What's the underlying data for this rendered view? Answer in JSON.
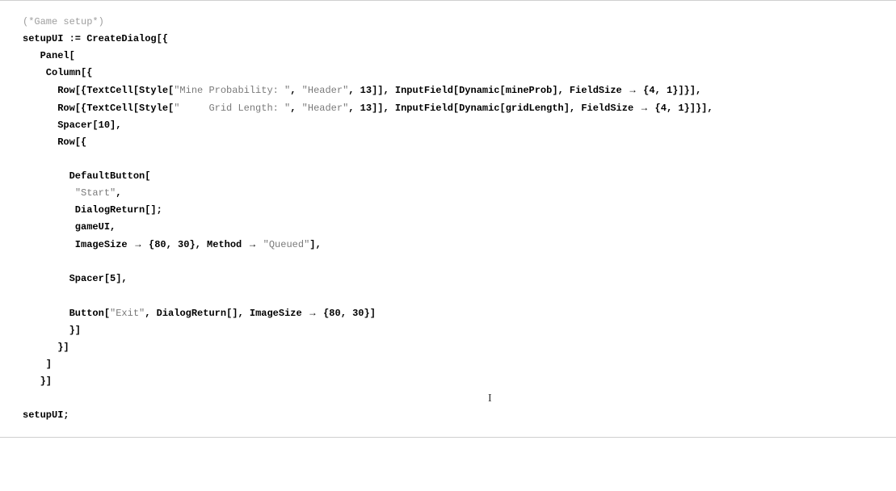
{
  "code": {
    "line1_comment": "(*Game setup*)",
    "line2": "setupUI := CreateDialog[{",
    "line3": "   Panel[",
    "line4": "    Column[{",
    "line5_a": "      Row[{TextCell[Style[",
    "line5_str1": "\"Mine Probability: \"",
    "line5_b": ", ",
    "line5_str2": "\"Header\"",
    "line5_c": ", 13]], InputField[Dynamic[mineProb], FieldSize ",
    "line5_d": " {4, 1}]}],",
    "line6_a": "      Row[{TextCell[Style[",
    "line6_str1": "\"     Grid Length: \"",
    "line6_b": ", ",
    "line6_str2": "\"Header\"",
    "line6_c": ", 13]], InputField[Dynamic[gridLength], FieldSize ",
    "line6_d": " {4, 1}]}],",
    "line7": "      Spacer[10],",
    "line8": "      Row[{",
    "line9": "        DefaultButton[",
    "line10_a": "         ",
    "line10_str": "\"Start\"",
    "line10_b": ",",
    "line11": "         DialogReturn[];",
    "line12": "         gameUI,",
    "line13_a": "         ImageSize ",
    "line13_b": " {80, 30}, Method ",
    "line13_str": " \"Queued\"",
    "line13_c": "],",
    "line14": "        Spacer[5],",
    "line15_a": "        Button[",
    "line15_str": "\"Exit\"",
    "line15_b": ", DialogReturn[], ImageSize ",
    "line15_c": " {80, 30}]",
    "line16": "        }]",
    "line17": "      }]",
    "line18": "    ]",
    "line19": "   }]",
    "line20": "",
    "line21": "setupUI;"
  },
  "arrow": "→"
}
